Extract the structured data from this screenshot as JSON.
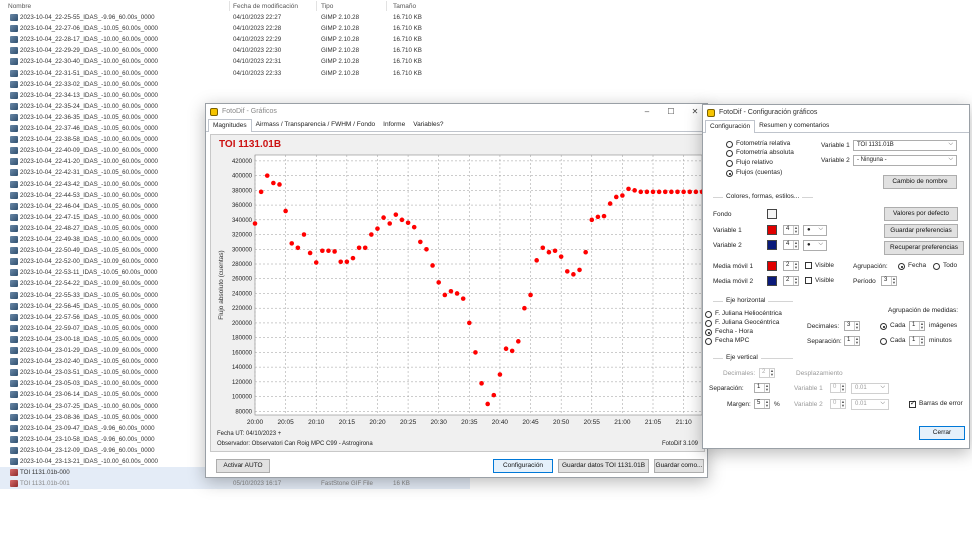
{
  "explorer": {
    "columns": {
      "name": "Nombre",
      "modified": "Fecha de modificación",
      "type": "Tipo",
      "size": "Tamaño"
    },
    "files": [
      {
        "name": "2023-10-04_22-25-55_IDAS_-9.96_60.00s_0000",
        "date": "04/10/2023 22:27",
        "type": "GIMP 2.10.28",
        "size": "16.710 KB"
      },
      {
        "name": "2023-10-04_22-27-06_IDAS_-10.05_60.00s_0000",
        "date": "04/10/2023 22:28",
        "type": "GIMP 2.10.28",
        "size": "16.710 KB"
      },
      {
        "name": "2023-10-04_22-28-17_IDAS_-10.00_60.00s_0000",
        "date": "04/10/2023 22:29",
        "type": "GIMP 2.10.28",
        "size": "16.710 KB"
      },
      {
        "name": "2023-10-04_22-29-29_IDAS_-10.00_60.00s_0000",
        "date": "04/10/2023 22:30",
        "type": "GIMP 2.10.28",
        "size": "16.710 KB"
      },
      {
        "name": "2023-10-04_22-30-40_IDAS_-10.00_60.00s_0000",
        "date": "04/10/2023 22:31",
        "type": "GIMP 2.10.28",
        "size": "16.710 KB"
      },
      {
        "name": "2023-10-04_22-31-51_IDAS_-10.00_60.00s_0000",
        "date": "04/10/2023 22:33",
        "type": "GIMP 2.10.28",
        "size": "16.710 KB"
      },
      {
        "name": "2023-10-04_22-33-02_IDAS_-10.00_60.00s_0000",
        "date": "",
        "type": "",
        "size": ""
      },
      {
        "name": "2023-10-04_22-34-13_IDAS_-10.00_60.00s_0000",
        "date": "",
        "type": "",
        "size": ""
      },
      {
        "name": "2023-10-04_22-35-24_IDAS_-10.00_60.00s_0000",
        "date": "",
        "type": "",
        "size": ""
      },
      {
        "name": "2023-10-04_22-36-35_IDAS_-10.05_60.00s_0000",
        "date": "",
        "type": "",
        "size": ""
      },
      {
        "name": "2023-10-04_22-37-46_IDAS_-10.05_60.00s_0000",
        "date": "",
        "type": "",
        "size": ""
      },
      {
        "name": "2023-10-04_22-38-58_IDAS_-10.00_60.00s_0000",
        "date": "",
        "type": "",
        "size": ""
      },
      {
        "name": "2023-10-04_22-40-09_IDAS_-10.00_60.00s_0000",
        "date": "",
        "type": "",
        "size": ""
      },
      {
        "name": "2023-10-04_22-41-20_IDAS_-10.00_60.00s_0000",
        "date": "",
        "type": "",
        "size": ""
      },
      {
        "name": "2023-10-04_22-42-31_IDAS_-10.05_60.00s_0000",
        "date": "",
        "type": "",
        "size": ""
      },
      {
        "name": "2023-10-04_22-43-42_IDAS_-10.00_60.00s_0000",
        "date": "",
        "type": "",
        "size": ""
      },
      {
        "name": "2023-10-04_22-44-53_IDAS_-10.00_60.00s_0000",
        "date": "",
        "type": "",
        "size": ""
      },
      {
        "name": "2023-10-04_22-46-04_IDAS_-10.05_60.00s_0000",
        "date": "",
        "type": "",
        "size": ""
      },
      {
        "name": "2023-10-04_22-47-15_IDAS_-10.00_60.00s_0000",
        "date": "",
        "type": "",
        "size": ""
      },
      {
        "name": "2023-10-04_22-48-27_IDAS_-10.05_60.00s_0000",
        "date": "",
        "type": "",
        "size": ""
      },
      {
        "name": "2023-10-04_22-49-38_IDAS_-10.00_60.00s_0000",
        "date": "",
        "type": "",
        "size": ""
      },
      {
        "name": "2023-10-04_22-50-49_IDAS_-10.05_60.00s_0000",
        "date": "",
        "type": "",
        "size": ""
      },
      {
        "name": "2023-10-04_22-52-00_IDAS_-10.09_60.00s_0000",
        "date": "",
        "type": "",
        "size": ""
      },
      {
        "name": "2023-10-04_22-53-11_IDAS_-10.05_60.00s_0000",
        "date": "",
        "type": "",
        "size": ""
      },
      {
        "name": "2023-10-04_22-54-22_IDAS_-10.09_60.00s_0000",
        "date": "",
        "type": "",
        "size": ""
      },
      {
        "name": "2023-10-04_22-55-33_IDAS_-10.05_60.00s_0000",
        "date": "",
        "type": "",
        "size": ""
      },
      {
        "name": "2023-10-04_22-56-45_IDAS_-10.05_60.00s_0000",
        "date": "",
        "type": "",
        "size": ""
      },
      {
        "name": "2023-10-04_22-57-56_IDAS_-10.05_60.00s_0000",
        "date": "",
        "type": "",
        "size": ""
      },
      {
        "name": "2023-10-04_22-59-07_IDAS_-10.05_60.00s_0000",
        "date": "",
        "type": "",
        "size": ""
      },
      {
        "name": "2023-10-04_23-00-18_IDAS_-10.05_60.00s_0000",
        "date": "",
        "type": "",
        "size": ""
      },
      {
        "name": "2023-10-04_23-01-29_IDAS_-10.09_60.00s_0000",
        "date": "",
        "type": "",
        "size": ""
      },
      {
        "name": "2023-10-04_23-02-40_IDAS_-10.05_60.00s_0000",
        "date": "",
        "type": "",
        "size": ""
      },
      {
        "name": "2023-10-04_23-03-51_IDAS_-10.05_60.00s_0000",
        "date": "",
        "type": "",
        "size": ""
      },
      {
        "name": "2023-10-04_23-05-03_IDAS_-10.00_60.00s_0000",
        "date": "",
        "type": "",
        "size": ""
      },
      {
        "name": "2023-10-04_23-06-14_IDAS_-10.05_60.00s_0000",
        "date": "",
        "type": "",
        "size": ""
      },
      {
        "name": "2023-10-04_23-07-25_IDAS_-10.00_60.00s_0000",
        "date": "",
        "type": "",
        "size": ""
      },
      {
        "name": "2023-10-04_23-08-36_IDAS_-10.05_60.00s_0000",
        "date": "04/10/2023 23:09",
        "type": "GIMP 2.10.28",
        "size": "16.710 KB"
      },
      {
        "name": "2023-10-04_23-09-47_IDAS_-9.96_60.00s_0000",
        "date": "04/10/2023 23:10",
        "type": "GIMP 2.10.28",
        "size": "16.710 KB"
      },
      {
        "name": "2023-10-04_23-10-58_IDAS_-9.96_60.00s_0000",
        "date": "04/10/2023 23:12",
        "type": "GIMP 2.10.28",
        "size": "16.710 KB"
      },
      {
        "name": "2023-10-04_23-12-09_IDAS_-9.96_60.00s_0000",
        "date": "04/10/2023 23:13",
        "type": "GIMP 2.10.28",
        "size": "16.710 KB"
      },
      {
        "name": "2023-10-04_23-13-21_IDAS_-10.00_60.00s_0000",
        "date": "04/10/2023 23:14",
        "type": "GIMP 2.10.28",
        "size": "16.710 KB"
      },
      {
        "name": "TOI 1131.01b-000",
        "date": "05/10/2023 16:14",
        "type": "FastStone GIF File",
        "size": "16 KB"
      },
      {
        "name": "TOI 1131.01b-001",
        "date": "05/10/2023 16:17",
        "type": "FastStone GIF File",
        "size": "16 KB"
      }
    ]
  },
  "graph_window": {
    "title": "FotoDif - Gráficos",
    "tabs": [
      "Magnitudes",
      "Airmass / Transparencia / FWHM / Fondo",
      "Informe",
      "Variables?"
    ],
    "plot_title": "TOI 1131.01B",
    "footer_date": "Fecha UT: 04/10/2023 +",
    "footer_observer": "Observador: Observatori Can Roig MPC C99 - Astrogirona",
    "version": "FotoDif 3.109",
    "buttons": {
      "activate": "Activar AUTO",
      "config": "Configuración",
      "save_data": "Guardar datos TOI 1131.01B",
      "save_as": "Guardar como..."
    }
  },
  "chart_data": {
    "type": "scatter",
    "title": "TOI 1131.01B",
    "xlabel": "",
    "ylabel": "Flujo absoluto (cuentas)",
    "x_ticks": [
      "20:00",
      "20:05",
      "20:10",
      "20:15",
      "20:20",
      "20:25",
      "20:30",
      "20:35",
      "20:40",
      "20:45",
      "20:50",
      "20:55",
      "21:00",
      "21:05",
      "21:10"
    ],
    "y_ticks": [
      "80000",
      "100000",
      "120000",
      "140000",
      "160000",
      "180000",
      "200000",
      "220000",
      "240000",
      "260000",
      "280000",
      "300000",
      "320000",
      "340000",
      "360000",
      "380000",
      "400000",
      "420000"
    ],
    "xlim": [
      "20:00",
      "21:13"
    ],
    "ylim": [
      75000,
      428000
    ],
    "grid": true,
    "marker_color": "#ff0000",
    "series": [
      {
        "x": [
          "20:00",
          "20:01",
          "20:02",
          "20:03",
          "20:04",
          "20:05",
          "20:06",
          "20:07",
          "20:08",
          "20:09",
          "20:10",
          "20:11",
          "20:12",
          "20:13",
          "20:14",
          "20:15",
          "20:16",
          "20:17",
          "20:18",
          "20:19",
          "20:20",
          "20:21",
          "20:22",
          "20:23",
          "20:24",
          "20:25",
          "20:26",
          "20:27",
          "20:28",
          "20:29",
          "20:30",
          "20:31",
          "20:32",
          "20:33",
          "20:34",
          "20:35",
          "20:36",
          "20:37",
          "20:38",
          "20:39",
          "20:40",
          "20:41",
          "20:42",
          "20:43",
          "20:44",
          "20:45",
          "20:46",
          "20:47",
          "20:48",
          "20:49",
          "20:50",
          "20:51",
          "20:52",
          "20:53",
          "20:54",
          "20:55",
          "20:56",
          "20:57",
          "20:58",
          "20:59",
          "21:00",
          "21:01",
          "21:02",
          "21:03",
          "21:04",
          "21:05",
          "21:06",
          "21:07",
          "21:08",
          "21:09",
          "21:10",
          "21:11",
          "21:12",
          "21:13"
        ],
        "y": [
          335000,
          378000,
          400000,
          390000,
          388000,
          352000,
          308000,
          302000,
          320000,
          295000,
          282000,
          298000,
          298000,
          297000,
          283000,
          283000,
          288000,
          302000,
          302000,
          320000,
          328000,
          343000,
          335000,
          347000,
          340000,
          336000,
          330000,
          310000,
          300000,
          278000,
          255000,
          238000,
          243000,
          240000,
          233000,
          200000,
          160000,
          118000,
          90000,
          102000,
          130000,
          165000,
          162000,
          175000,
          220000,
          238000,
          285000,
          302000,
          296000,
          298000,
          290000,
          270000,
          266000,
          272000,
          296000,
          340000,
          344000,
          345000,
          362000,
          371000,
          373000,
          382000,
          380000,
          378000,
          378000,
          378000,
          378000,
          378000,
          378000,
          378000,
          378000,
          378000,
          378000,
          378000
        ]
      }
    ]
  },
  "config_window": {
    "title": "FotoDif - Configuración gráficos",
    "tabs": [
      "Configuración",
      "Resumen y comentarios"
    ],
    "radios_mode": [
      "Fotometría relativa",
      "Fotometría absoluta",
      "Flujo relativo",
      "Flujos (cuentas)"
    ],
    "variable1_label": "Variable 1",
    "variable1_value": "TOI 1131.01B",
    "variable2_label": "Variable 2",
    "variable2_value": "- Ninguna -",
    "rename_button": "Cambio de nombre",
    "group_colors": "Colores, formas, estilos...",
    "fondo": "Fondo",
    "var1": "Variable 1",
    "var2": "Variable 2",
    "var1_size": "4",
    "var2_size": "4",
    "mm1": "Media móvil 1",
    "mm2": "Media móvil 2",
    "mm1_val": "2",
    "mm2_val": "2",
    "visible": "Visible",
    "agrupacion": "Agrupación:",
    "fecha": "Fecha",
    "todo": "Todo",
    "periodo": "Período",
    "periodo_val": "3",
    "btn_defaults": "Valores por defecto",
    "btn_save_prefs": "Guardar preferencias",
    "btn_recover_prefs": "Recuperar preferencias",
    "group_h": "Eje horizontal",
    "h_radios": [
      "F. Juliana Heliocéntrica",
      "F. Juliana Geocéntrica",
      "Fecha - Hora",
      "Fecha MPC"
    ],
    "decimales": "Decimales:",
    "decimales_val": "3",
    "separacion": "Separación:",
    "separacion_val": "1",
    "agrup_medidas": "Agrupación de medidas:",
    "cada": "Cada",
    "cada1_val": "1",
    "imagenes": "imágenes",
    "cada2_val": "1",
    "minutos": "minutos",
    "group_v": "Eje vertical",
    "v_decimales": "Decimales:",
    "v_decimales_val": "2",
    "desplazamiento": "Desplazamiento",
    "v_separacion": "Separación:",
    "v_separacion_val": "1",
    "v_var1": "Variable 1",
    "v_var1_val": "0",
    "v_var1_off": "0.01",
    "margen": "Margen:",
    "margen_val": "5",
    "pct": "%",
    "v_var2": "Variable 2",
    "v_var2_val": "0",
    "v_var2_off": "0.01",
    "barras_error": "Barras de error",
    "close_button": "Cerrar"
  },
  "colors": {
    "var1": "#e00000",
    "var2": "#0a1a7a",
    "mm1": "#e00000",
    "mm2": "#0a1a7a",
    "accent": "#0078d7"
  }
}
